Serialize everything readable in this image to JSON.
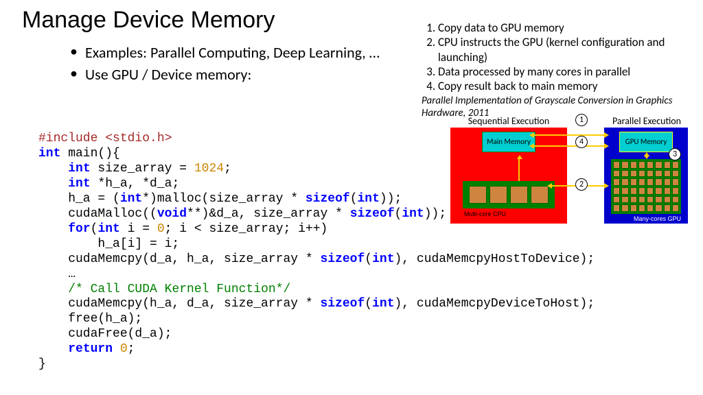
{
  "title": "Manage Device Memory",
  "bullets": [
    "Examples: Parallel Computing, Deep Learning, …",
    "Use GPU / Device memory:"
  ],
  "steps": [
    "Copy data to GPU memory",
    "CPU instructs the GPU (kernel configuration and launching)",
    "Data processed by many cores in parallel",
    "Copy result back to main memory"
  ],
  "citation": "Parallel Implementation of Grayscale Conversion in Graphics Hardware, 2011",
  "diagram": {
    "seq_label": "Sequential Execution",
    "par_label": "Parallel Execution",
    "main_mem": "Main Memory",
    "gpu_mem": "GPU Memory",
    "multicore": "Multi-core CPU",
    "manycore": "Many-cores GPU",
    "n1": "1",
    "n2": "2",
    "n3": "3",
    "n4": "4"
  },
  "code": {
    "l1a": "#include <stdio.h>",
    "l2a": "int",
    "l2b": " main(){",
    "l3a": "int",
    "l3b": " size_array = ",
    "l3c": "1024",
    "l3d": ";",
    "l4a": "int",
    "l4b": " *h_a, *d_a;",
    "l5a": "    h_a = (",
    "l5b": "int",
    "l5c": "*)malloc(size_array * ",
    "l5d": "sizeof",
    "l5e": "(",
    "l5f": "int",
    "l5g": "));",
    "l6a": "    cudaMalloc((",
    "l6b": "void",
    "l6c": "**)&d_a, size_array * ",
    "l6d": "sizeof",
    "l6e": "(",
    "l6f": "int",
    "l6g": "));",
    "l7a": "for",
    "l7b": "(",
    "l7c": "int",
    "l7d": " i = ",
    "l7e": "0",
    "l7f": "; i < size_array; i++)",
    "l8": "        h_a[i] = i;",
    "l9a": "    cudaMemcpy(d_a, h_a, size_array * ",
    "l9b": "sizeof",
    "l9c": "(",
    "l9d": "int",
    "l9e": "), cudaMemcpyHostToDevice);",
    "l10": "…",
    "l11": "/* Call CUDA Kernel Function*/",
    "l12a": "    cudaMemcpy(h_a, d_a, size_array * ",
    "l12b": "sizeof",
    "l12c": "(",
    "l12d": "int",
    "l12e": "), cudaMemcpyDeviceToHost);",
    "l13": "    free(h_a);",
    "l14": "    cudaFree(d_a);",
    "l15a": "return",
    "l15b": " ",
    "l15c": "0",
    "l15d": ";",
    "l16": "}"
  }
}
